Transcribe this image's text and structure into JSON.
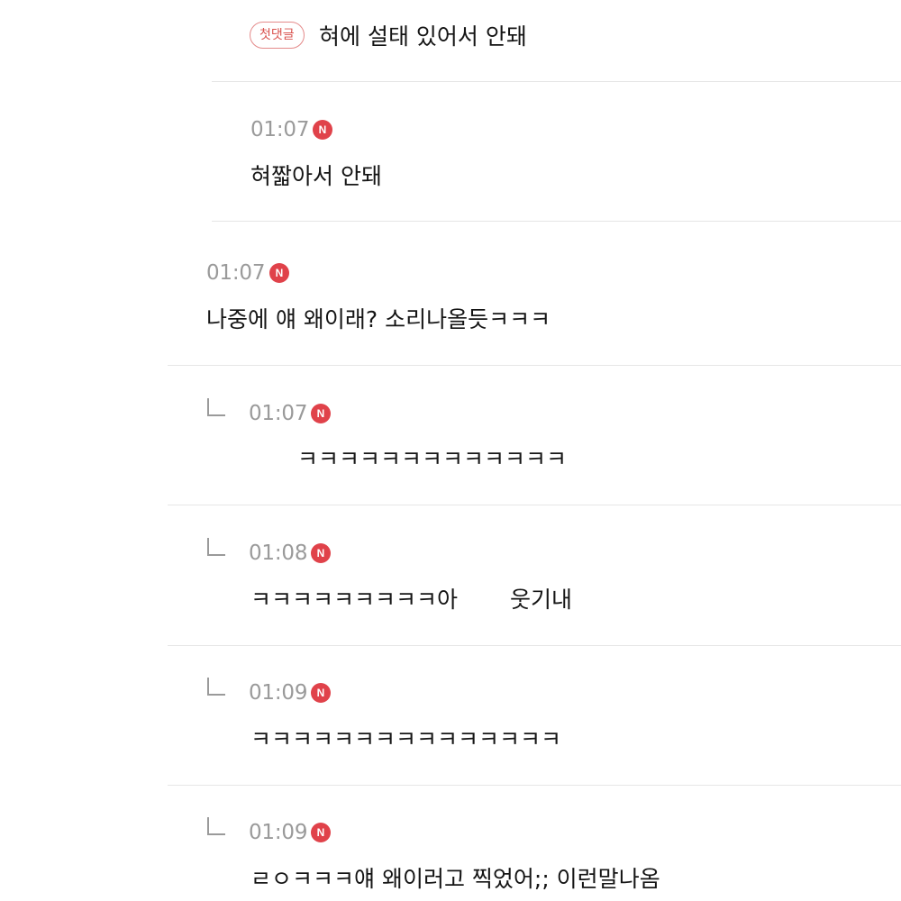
{
  "colors": {
    "new_badge": "#e0424a",
    "first_badge_border": "#e48a8a",
    "first_badge_text": "#d9534f",
    "timestamp": "#9a9a9a",
    "divider": "#e6e6e6"
  },
  "icons": {
    "new": "new-badge-icon",
    "reply": "reply-arrow-icon"
  },
  "comments": [
    {
      "badge": "첫댓글",
      "text": "혀에 설태 있어서 안돼"
    },
    {
      "time": "01:07",
      "new_label": "N",
      "text": "혀짧아서 안돼"
    },
    {
      "time": "01:07",
      "new_label": "N",
      "text": "나중에 얘 왜이래? 소리나올듯ㅋㅋㅋ"
    },
    {
      "time": "01:07",
      "new_label": "N",
      "text": "ㅋㅋㅋㅋㅋㅋㅋㅋㅋㅋㅋㅋㅋ"
    },
    {
      "time": "01:08",
      "new_label": "N",
      "text": "ㅋㅋㅋㅋㅋㅋㅋㅋㅋ아",
      "text_tail": "웃기내"
    },
    {
      "time": "01:09",
      "new_label": "N",
      "text": "ㅋㅋㅋㅋㅋㅋㅋㅋㅋㅋㅋㅋㅋㅋㅋ"
    },
    {
      "time": "01:09",
      "new_label": "N",
      "text": "ㄹㅇㅋㅋㅋ얘 왜이러고 찍었어;; 이런말나옴"
    }
  ]
}
